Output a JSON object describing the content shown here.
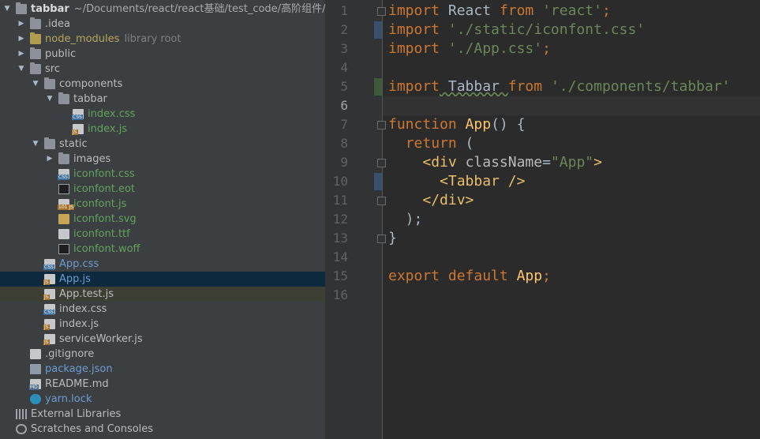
{
  "project_tree": {
    "root": {
      "name": "tabbar",
      "path": "~/Documents/react/react基础/test_code/高阶组件/tabb"
    },
    "rows": [
      {
        "label": "tabbar",
        "extra": "~/Documents/react/react基础/test_code/高阶组件/tabb",
        "type": "folder",
        "arrow": "▼"
      },
      {
        "label": ".idea",
        "type": "folder",
        "arrow": "▶"
      },
      {
        "label": "node_modules",
        "extra": "library root",
        "type": "folder-yellow",
        "arrow": "▶"
      },
      {
        "label": "public",
        "type": "folder",
        "arrow": "▶"
      },
      {
        "label": "src",
        "type": "folder",
        "arrow": "▼"
      },
      {
        "label": "components",
        "type": "folder",
        "arrow": "▼"
      },
      {
        "label": "tabbar",
        "type": "folder",
        "arrow": "▼"
      },
      {
        "label": "index.css",
        "type": "css"
      },
      {
        "label": "index.js",
        "type": "js"
      },
      {
        "label": "static",
        "type": "folder",
        "arrow": "▼"
      },
      {
        "label": "images",
        "type": "folder",
        "arrow": "▶"
      },
      {
        "label": "iconfont.css",
        "type": "css"
      },
      {
        "label": "iconfont.eot",
        "type": "black"
      },
      {
        "label": "iconfont.js",
        "type": "js101"
      },
      {
        "label": "iconfont.svg",
        "type": "svg"
      },
      {
        "label": "iconfont.ttf",
        "type": "file"
      },
      {
        "label": "iconfont.woff",
        "type": "black"
      },
      {
        "label": "App.css",
        "type": "css"
      },
      {
        "label": "App.js",
        "type": "js"
      },
      {
        "label": "App.test.js",
        "type": "test"
      },
      {
        "label": "index.css",
        "type": "css"
      },
      {
        "label": "index.js",
        "type": "js"
      },
      {
        "label": "serviceWorker.js",
        "type": "js"
      },
      {
        "label": ".gitignore",
        "type": "file"
      },
      {
        "label": "package.json",
        "type": "json"
      },
      {
        "label": "README.md",
        "type": "md"
      },
      {
        "label": "yarn.lock",
        "type": "yarn"
      },
      {
        "label": "External Libraries",
        "type": "libs"
      },
      {
        "label": "Scratches and Consoles",
        "type": "scratch"
      }
    ],
    "icon_badges": {
      "css": "CSS",
      "js": "JS",
      "md": "MD",
      "bin": "101"
    }
  },
  "editor": {
    "line_numbers": [
      "1",
      "2",
      "3",
      "4",
      "5",
      "6",
      "7",
      "8",
      "9",
      "10",
      "11",
      "12",
      "13",
      "14",
      "15",
      "16"
    ],
    "current_line": "6",
    "lines": [
      {
        "n": "1",
        "tokens": [
          [
            "kw",
            "import"
          ],
          [
            "plain",
            " React "
          ],
          [
            "kw",
            "from"
          ],
          [
            "plain",
            " "
          ],
          [
            "str",
            "'react'"
          ],
          [
            "kw",
            ";"
          ]
        ]
      },
      {
        "n": "2",
        "tokens": [
          [
            "kw",
            "import"
          ],
          [
            "plain",
            " "
          ],
          [
            "str",
            "'./static/iconfont.css'"
          ]
        ]
      },
      {
        "n": "3",
        "tokens": [
          [
            "kw",
            "import"
          ],
          [
            "plain",
            " "
          ],
          [
            "str",
            "'./App.css'"
          ],
          [
            "kw",
            ";"
          ]
        ]
      },
      {
        "n": "4",
        "tokens": []
      },
      {
        "n": "5",
        "tokens": [
          [
            "kw",
            "import"
          ],
          [
            "plain",
            " Tabbar "
          ],
          [
            "kw",
            "from"
          ],
          [
            "plain",
            " "
          ],
          [
            "str",
            "'./components/tabbar'"
          ]
        ]
      },
      {
        "n": "6",
        "tokens": []
      },
      {
        "n": "7",
        "tokens": [
          [
            "kw",
            "function"
          ],
          [
            "plain",
            " "
          ],
          [
            "fn",
            "App"
          ],
          [
            "plain",
            "() {"
          ]
        ]
      },
      {
        "n": "8",
        "tokens": [
          [
            "plain",
            "  "
          ],
          [
            "kw",
            "return"
          ],
          [
            "plain",
            " ("
          ]
        ]
      },
      {
        "n": "9",
        "tokens": [
          [
            "plain",
            "    "
          ],
          [
            "tag",
            "<div"
          ],
          [
            "plain",
            " "
          ],
          [
            "attr",
            "className"
          ],
          [
            "plain",
            "="
          ],
          [
            "str",
            "\"App\""
          ],
          [
            "tag",
            ">"
          ]
        ]
      },
      {
        "n": "10",
        "tokens": [
          [
            "plain",
            "      "
          ],
          [
            "tag",
            "<Tabbar />"
          ]
        ]
      },
      {
        "n": "11",
        "tokens": [
          [
            "plain",
            "    "
          ],
          [
            "tag",
            "</div>"
          ]
        ]
      },
      {
        "n": "12",
        "tokens": [
          [
            "plain",
            "  );"
          ]
        ]
      },
      {
        "n": "13",
        "tokens": [
          [
            "plain",
            "}"
          ]
        ]
      },
      {
        "n": "14",
        "tokens": []
      },
      {
        "n": "15",
        "tokens": [
          [
            "kw",
            "export"
          ],
          [
            "plain",
            " "
          ],
          [
            "kw",
            "default"
          ],
          [
            "plain",
            " "
          ],
          [
            "fn",
            "App"
          ],
          [
            "kw",
            ";"
          ]
        ]
      },
      {
        "n": "16",
        "tokens": []
      }
    ]
  },
  "colors": {
    "tree_bg": "#3c3f41",
    "editor_bg": "#2b2b2b",
    "selection": "#0d293e",
    "keyword": "#cc7832",
    "string": "#6a8759",
    "function": "#ffc66d",
    "tag": "#e8bf6a"
  }
}
